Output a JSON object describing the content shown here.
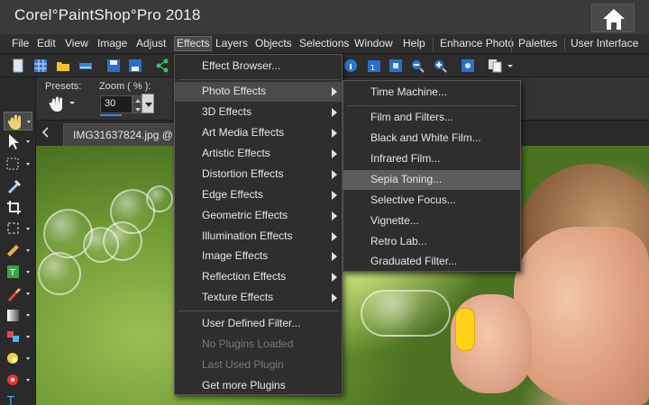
{
  "app": {
    "title": "Corel°PaintShop°Pro 2018"
  },
  "menubar": [
    {
      "id": "file",
      "label": "File"
    },
    {
      "id": "edit",
      "label": "Edit"
    },
    {
      "id": "view",
      "label": "View"
    },
    {
      "id": "image",
      "label": "Image"
    },
    {
      "id": "adjust",
      "label": "Adjust"
    },
    {
      "id": "effects",
      "label": "Effects",
      "active": true
    },
    {
      "id": "layers",
      "label": "Layers"
    },
    {
      "id": "objects",
      "label": "Objects"
    },
    {
      "id": "selections",
      "label": "Selections"
    },
    {
      "id": "window",
      "label": "Window"
    },
    {
      "id": "help",
      "label": "Help"
    },
    {
      "id": "enhance",
      "label": "Enhance Photo"
    },
    {
      "id": "palettes",
      "label": "Palettes"
    },
    {
      "id": "ui",
      "label": "User Interface"
    }
  ],
  "tool_options": {
    "presets_label": "Presets:",
    "zoom_label": "Zoom ( % ):",
    "zoom_value": "30"
  },
  "document": {
    "tab_title": "IMG31637824.jpg @"
  },
  "effects_menu": [
    {
      "label": "Effect Browser...",
      "submenu": false,
      "disabled": false
    },
    {
      "label": "Photo Effects",
      "submenu": true,
      "disabled": false,
      "highlight": true
    },
    {
      "label": "3D Effects",
      "submenu": true,
      "disabled": false
    },
    {
      "label": "Art Media Effects",
      "submenu": true,
      "disabled": false
    },
    {
      "label": "Artistic Effects",
      "submenu": true,
      "disabled": false
    },
    {
      "label": "Distortion Effects",
      "submenu": true,
      "disabled": false
    },
    {
      "label": "Edge Effects",
      "submenu": true,
      "disabled": false
    },
    {
      "label": "Geometric Effects",
      "submenu": true,
      "disabled": false
    },
    {
      "label": "Illumination Effects",
      "submenu": true,
      "disabled": false
    },
    {
      "label": "Image Effects",
      "submenu": true,
      "disabled": false
    },
    {
      "label": "Reflection Effects",
      "submenu": true,
      "disabled": false
    },
    {
      "label": "Texture Effects",
      "submenu": true,
      "disabled": false
    },
    {
      "label": "User Defined Filter...",
      "submenu": false,
      "disabled": false
    },
    {
      "label": "No Plugins Loaded",
      "submenu": false,
      "disabled": true
    },
    {
      "label": "Last Used Plugin",
      "submenu": false,
      "disabled": true
    },
    {
      "label": "Get more Plugins",
      "submenu": false,
      "disabled": false
    }
  ],
  "photo_effects_submenu": [
    {
      "label": "Time Machine..."
    },
    {
      "label": "Film and Filters..."
    },
    {
      "label": "Black and White Film..."
    },
    {
      "label": "Infrared Film..."
    },
    {
      "label": "Sepia Toning...",
      "highlight": true
    },
    {
      "label": "Selective Focus..."
    },
    {
      "label": "Vignette..."
    },
    {
      "label": "Retro Lab..."
    },
    {
      "label": "Graduated Filter..."
    }
  ],
  "icons": {
    "home": "home-icon",
    "accent": "#3a8ad8",
    "wand_color": "#ffd21a"
  }
}
